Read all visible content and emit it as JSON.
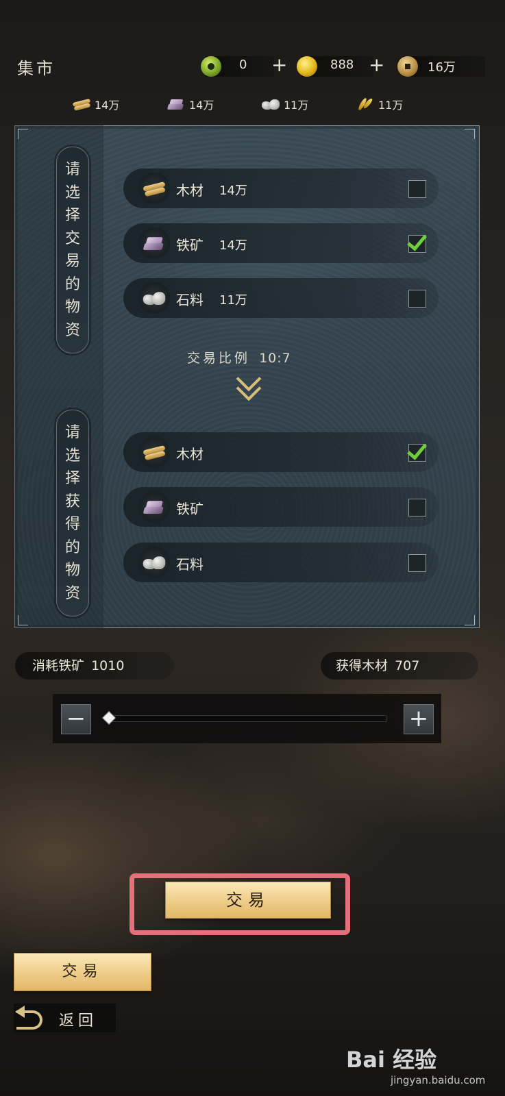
{
  "header": {
    "title": "集市",
    "currencies": [
      {
        "icon": "jade-icon",
        "value": "0"
      },
      {
        "icon": "gold-ingot-icon",
        "value": "888"
      },
      {
        "icon": "copper-coin-icon",
        "value": "16万"
      }
    ],
    "plus_label": "+"
  },
  "resources": [
    {
      "icon": "wood-icon",
      "value": "14万"
    },
    {
      "icon": "iron-icon",
      "value": "14万"
    },
    {
      "icon": "stone-icon",
      "value": "11万"
    },
    {
      "icon": "grain-icon",
      "value": "11万"
    }
  ],
  "trade_panel": {
    "give_label": [
      "请",
      "选",
      "择",
      "交",
      "易",
      "的",
      "物",
      "资"
    ],
    "receive_label": [
      "请",
      "选",
      "择",
      "获",
      "得",
      "的",
      "物",
      "资"
    ],
    "give_items": [
      {
        "name": "木材",
        "qty": "14万",
        "checked": false
      },
      {
        "name": "铁矿",
        "qty": "14万",
        "checked": true
      },
      {
        "name": "石料",
        "qty": "11万",
        "checked": false
      }
    ],
    "receive_items": [
      {
        "name": "木材",
        "checked": true
      },
      {
        "name": "铁矿",
        "checked": false
      },
      {
        "name": "石料",
        "checked": false
      }
    ],
    "ratio_label": "交易比例",
    "ratio_value": "10:7"
  },
  "summary": {
    "consume_label": "消耗铁矿",
    "consume_value": "1010",
    "gain_label": "获得木材",
    "gain_value": "707"
  },
  "slider": {
    "minus": "−",
    "plus": "+",
    "level": 0
  },
  "buttons": {
    "trade_main": "交易",
    "trade_side": "交易",
    "back": "返回"
  },
  "watermark": {
    "brand": "Bai 经验",
    "url": "jingyan.baidu.com"
  }
}
